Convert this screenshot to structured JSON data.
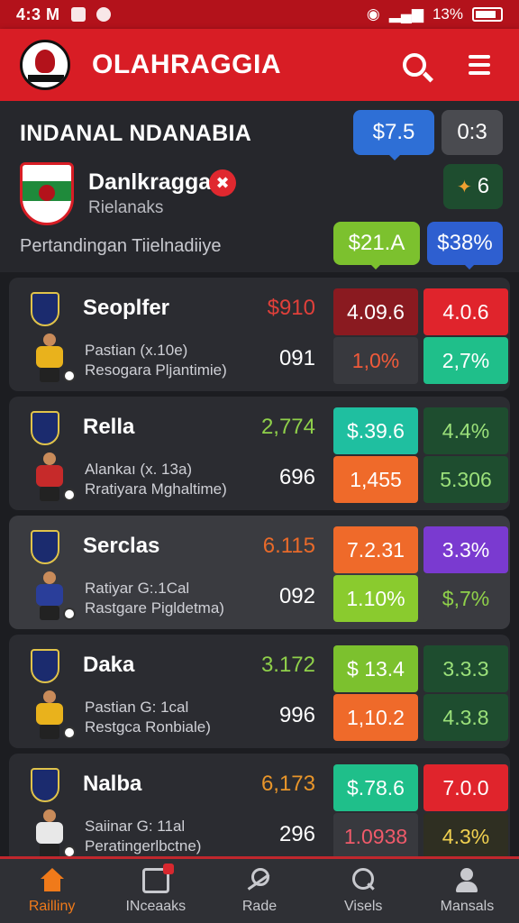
{
  "status_bar": {
    "time": "4:3 M",
    "signal": "13%",
    "icon_names": [
      "app-icon",
      "location-icon",
      "eye-icon",
      "battery-icon"
    ]
  },
  "header": {
    "title": "OLAHRAGGIA",
    "icons": [
      "logo-icon",
      "search-icon",
      "menu-icon"
    ]
  },
  "info": {
    "league": "INDANAL NDANABIA",
    "chip_1": "$7.5",
    "chip_2": "0:3",
    "team_name": "Danlkragga",
    "team_sub": "Rielanaks",
    "live_badge": "✖",
    "leaf_value": "6",
    "subtitle": "Pertandingan Tiielnadiiye",
    "chip_3": "$21.A",
    "chip_4": "$38%"
  },
  "colors": {
    "header": "#d81d25",
    "status": "#b3121b",
    "active_nav": "#f07a1a"
  },
  "matches": [
    {
      "name": "Seoplfer",
      "price": "$910",
      "price_color": "#e0403a",
      "desc_1": "Pastian (x.10e)",
      "desc_2": "Resogara Pljantimie)",
      "count": "091",
      "kit": "#e9b21c",
      "odds": [
        {
          "v": "4.09.6",
          "bg": "#8a1a20",
          "fg": "#ffffff"
        },
        {
          "v": "4.0.6",
          "bg": "#e0242c",
          "fg": "#ffffff"
        },
        {
          "v": "1,0%",
          "bg": "#38393e",
          "fg": "#f05a3a"
        },
        {
          "v": "2,7%",
          "bg": "#1fbf8a",
          "fg": "#ffffff"
        }
      ]
    },
    {
      "name": "Rella",
      "price": "2,774",
      "price_color": "#8fd04a",
      "desc_1": "Alankaı (x. 13a)",
      "desc_2": "Rratiyara Mghaltime)",
      "count": "696",
      "kit": "#c62a2a",
      "odds": [
        {
          "v": "$.39.6",
          "bg": "#1fbfa0",
          "fg": "#ffffff"
        },
        {
          "v": "4.4%",
          "bg": "#1e4d2f",
          "fg": "#9be07a"
        },
        {
          "v": "1,455",
          "bg": "#ef6a2a",
          "fg": "#ffffff"
        },
        {
          "v": "5.306",
          "bg": "#1e4d2f",
          "fg": "#9be07a"
        }
      ]
    },
    {
      "name": "Serclas",
      "price": "6.115",
      "price_color": "#e86a2a",
      "desc_1": "Ratiyar G:.1Cal",
      "desc_2": "Rastgare Pigldetma)",
      "count": "092",
      "kit": "#2a3e9a",
      "odds": [
        {
          "v": "7.2.31",
          "bg": "#ef6a2a",
          "fg": "#ffffff"
        },
        {
          "v": "3.3%",
          "bg": "#7a3ad0",
          "fg": "#ffffff"
        },
        {
          "v": "1.10%",
          "bg": "#8acb2e",
          "fg": "#ffffff"
        },
        {
          "v": "$,7%",
          "bg": "#3a3b40",
          "fg": "#8fd04a"
        }
      ]
    },
    {
      "name": "Daka",
      "price": "3.172",
      "price_color": "#8fd04a",
      "desc_1": "Pastian G: 1cal",
      "desc_2": "Restgca Ronbiale)",
      "count": "996",
      "kit": "#e9b21c",
      "odds": [
        {
          "v": "$ 13.4",
          "bg": "#7cc12e",
          "fg": "#ffffff"
        },
        {
          "v": "3.3.3",
          "bg": "#1e4d2f",
          "fg": "#9be07a"
        },
        {
          "v": "1,10.2",
          "bg": "#ef6a2a",
          "fg": "#ffffff"
        },
        {
          "v": "4.3.8",
          "bg": "#1e4d2f",
          "fg": "#9be07a"
        }
      ]
    },
    {
      "name": "Nalba",
      "price": "6,173",
      "price_color": "#e8952a",
      "desc_1": "Saiinar G: 11al",
      "desc_2": "Peratingerlbctne)",
      "count": "296",
      "kit": "#e8e8e8",
      "odds": [
        {
          "v": "$.78.6",
          "bg": "#1fbf8a",
          "fg": "#ffffff"
        },
        {
          "v": "7.0.0",
          "bg": "#e0242c",
          "fg": "#ffffff"
        },
        {
          "v": "1.0938",
          "bg": "#38393e",
          "fg": "#f05a6a"
        },
        {
          "v": "4.3%",
          "bg": "#2f2f22",
          "fg": "#f0d050"
        }
      ]
    }
  ],
  "nav": [
    {
      "label": "Railliny",
      "icon": "home-icon",
      "active": true
    },
    {
      "label": "INceaaks",
      "icon": "news-icon",
      "active": false
    },
    {
      "label": "Rade",
      "icon": "trade-icon",
      "active": false
    },
    {
      "label": "Visels",
      "icon": "search-icon",
      "active": false
    },
    {
      "label": "Mansals",
      "icon": "user-icon",
      "active": false
    }
  ]
}
